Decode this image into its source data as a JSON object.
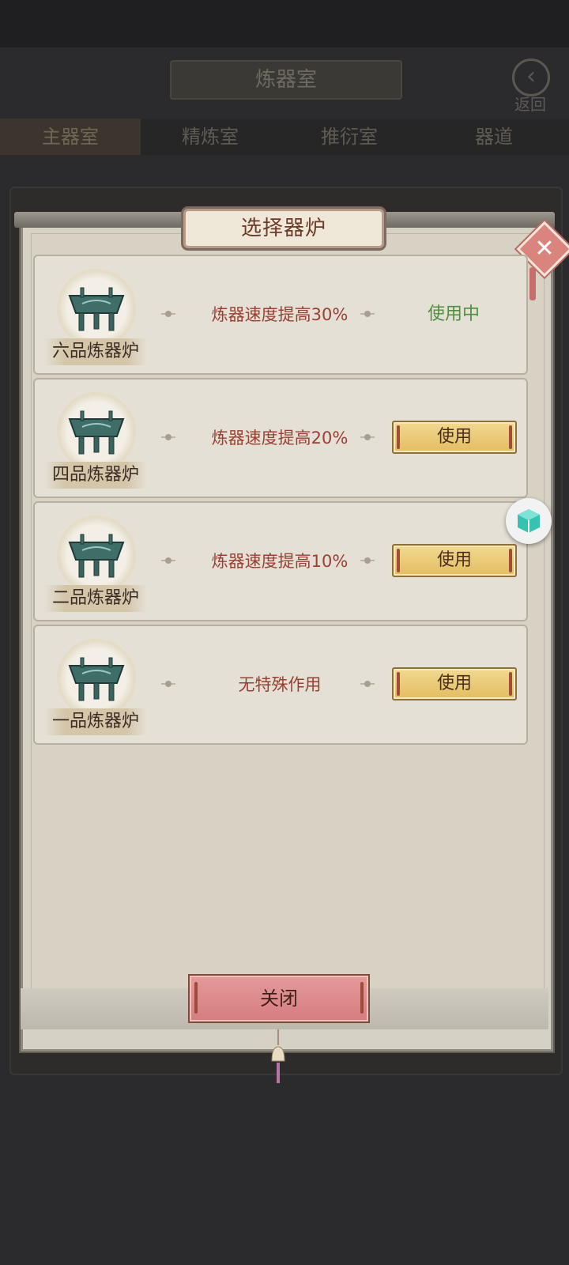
{
  "background": {
    "header_title": "炼器室",
    "back_label": "返回",
    "tabs": [
      "主器室",
      "精炼室",
      "推衍室",
      "器道"
    ]
  },
  "dialog": {
    "title": "选择器炉",
    "close_button": "关闭",
    "items": [
      {
        "name": "六品炼器炉",
        "effect": "炼器速度提高30%",
        "status": "使用中",
        "in_use": true
      },
      {
        "name": "四品炼器炉",
        "effect": "炼器速度提高20%",
        "action": "使用",
        "in_use": false
      },
      {
        "name": "二品炼器炉",
        "effect": "炼器速度提高10%",
        "action": "使用",
        "in_use": false
      },
      {
        "name": "一品炼器炉",
        "effect": "无特殊作用",
        "action": "使用",
        "in_use": false
      }
    ]
  },
  "icons": {
    "furnace": "bronze-cauldron-icon",
    "close": "close-x-icon",
    "back": "back-arrow-icon",
    "floating": "cube-icon"
  },
  "colors": {
    "effect_text": "#9a4032",
    "in_use_text": "#4e9040",
    "use_button": "#e3bd62",
    "close_button": "#d57d80"
  }
}
